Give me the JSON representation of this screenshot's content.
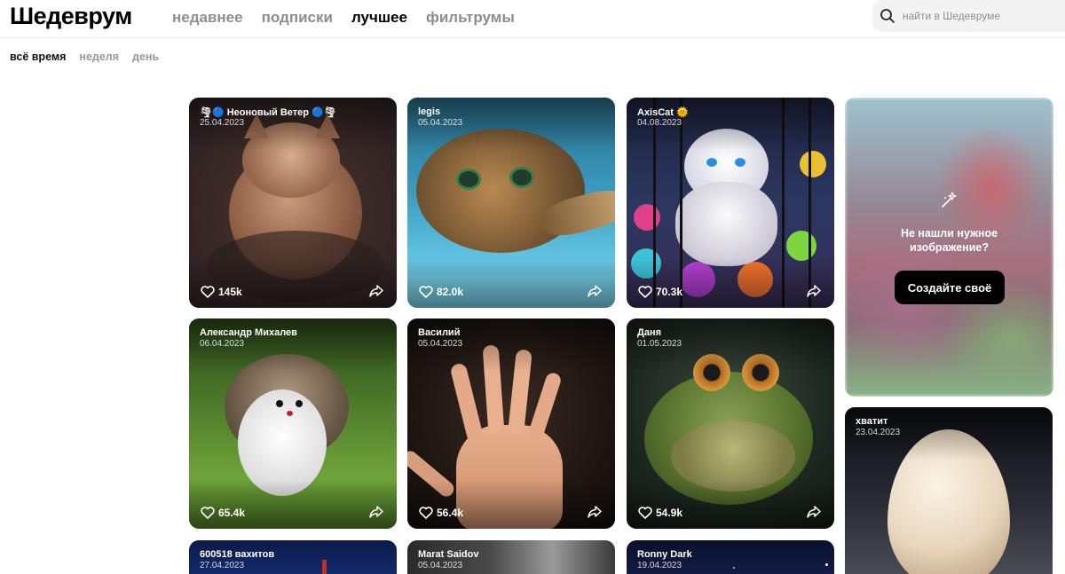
{
  "app": {
    "logo": "Шедеврум"
  },
  "nav": {
    "items": [
      {
        "label": "недавнее",
        "active": false
      },
      {
        "label": "подписки",
        "active": false
      },
      {
        "label": "лучшее",
        "active": true
      },
      {
        "label": "фильтрумы",
        "active": false
      }
    ]
  },
  "search": {
    "placeholder": "найти в Шедевруме",
    "value": ""
  },
  "period": {
    "items": [
      {
        "label": "всё время",
        "active": true
      },
      {
        "label": "неделя",
        "active": false
      },
      {
        "label": "день",
        "active": false
      }
    ]
  },
  "cards": [
    {
      "author": "🌪🔵 Неоновый Ветер 🔵🌪",
      "date": "25.04.2023",
      "likes": "145k",
      "subject": "fat-cat"
    },
    {
      "author": "legis",
      "date": "05.04.2023",
      "likes": "82.0k",
      "subject": "swimming-cat"
    },
    {
      "author": "AxisCat 🌞",
      "date": "04.08.2023",
      "likes": "70.3k",
      "subject": "kittens-cage"
    },
    {
      "author": "Александр Михалев",
      "date": "06.04.2023",
      "likes": "65.4k",
      "subject": "hedgehog"
    },
    {
      "author": "Василий",
      "date": "05.04.2023",
      "likes": "56.4k",
      "subject": "hand"
    },
    {
      "author": "Даня",
      "date": "01.05.2023",
      "likes": "54.9k",
      "subject": "frog"
    },
    {
      "author": "хватит",
      "date": "23.04.2023",
      "likes": "",
      "subject": "egg"
    },
    {
      "author": "600518 вахитов",
      "date": "27.04.2023",
      "likes": "",
      "subject": "night"
    },
    {
      "author": "Marat Saidov",
      "date": "05.04.2023",
      "likes": "",
      "subject": "dark"
    },
    {
      "author": "Ronny Dark",
      "date": "19.04.2023",
      "likes": "",
      "subject": "space"
    }
  ],
  "promo": {
    "line1": "Не нашли нужное",
    "line2": "изображение?",
    "button": "Создайте своё"
  },
  "icons": {
    "like": "heart-icon",
    "share": "share-icon",
    "search": "search-icon",
    "promo": "sparkle-icon"
  }
}
